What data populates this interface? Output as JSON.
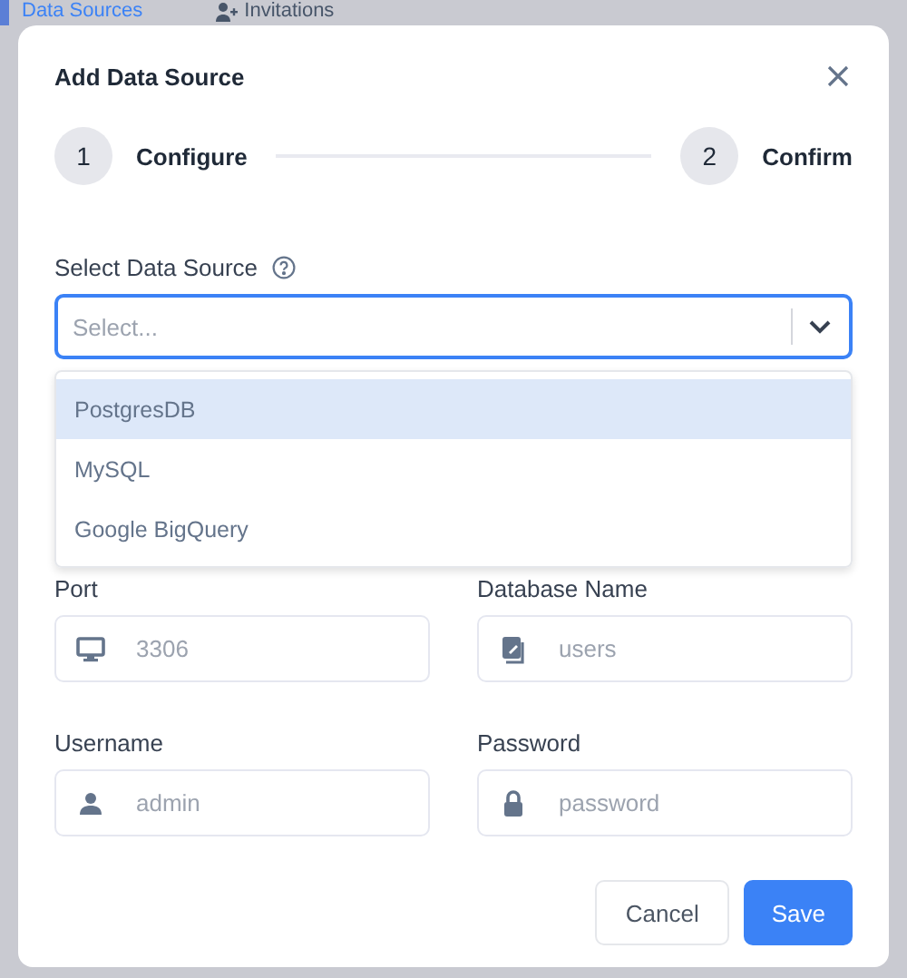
{
  "background_tabs": [
    {
      "label": "Data Sources",
      "kind": "plain",
      "selected": true
    },
    {
      "label": "Invitations",
      "kind": "with_icon",
      "selected": false
    }
  ],
  "dialog": {
    "title": "Add Data Source",
    "steps": [
      {
        "number": "1",
        "label": "Configure"
      },
      {
        "number": "2",
        "label": "Confirm"
      }
    ],
    "select": {
      "label": "Select Data Source",
      "placeholder": "Select...",
      "options": [
        {
          "label": "PostgresDB",
          "selected": true
        },
        {
          "label": "MySQL",
          "selected": false
        },
        {
          "label": "Google BigQuery",
          "selected": false
        }
      ]
    },
    "fields": [
      {
        "label": "Port",
        "placeholder": "3306",
        "kind": "monitor"
      },
      {
        "label": "Database Name",
        "placeholder": "users",
        "kind": "document"
      },
      {
        "label": "Username",
        "placeholder": "admin",
        "kind": "person"
      },
      {
        "label": "Password",
        "placeholder": "password",
        "kind": "lock"
      }
    ],
    "buttons": [
      {
        "label": "Cancel",
        "kind": "secondary"
      },
      {
        "label": "Save",
        "kind": "primary"
      }
    ]
  }
}
